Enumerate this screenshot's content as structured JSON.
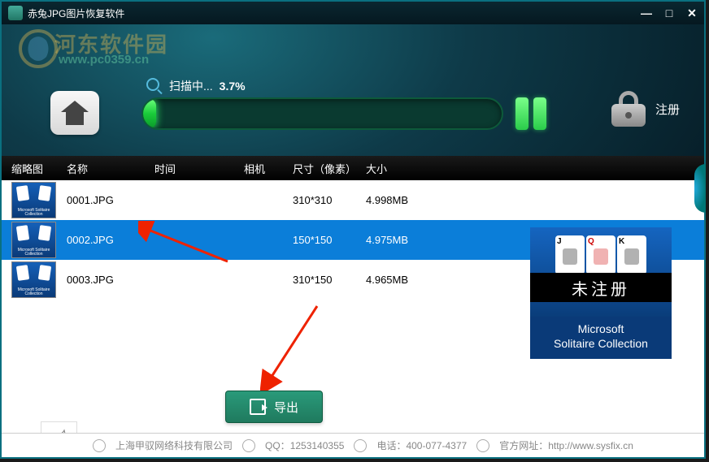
{
  "window": {
    "title": "赤兔JPG图片恢复软件"
  },
  "watermark": {
    "site_name": "河东软件园",
    "url": "www.pc0359.cn"
  },
  "scan": {
    "status_label": "扫描中...",
    "percent": "3.7%",
    "progress_value": 3.7
  },
  "register": {
    "label": "注册"
  },
  "table": {
    "headers": {
      "thumbnail": "缩略图",
      "name": "名称",
      "time": "时间",
      "camera": "相机",
      "dimensions": "尺寸（像素）",
      "size": "大小"
    },
    "rows": [
      {
        "name": "0001.JPG",
        "time": "",
        "camera": "",
        "dimensions": "310*310",
        "size": "4.998MB",
        "thumb_caption": "Microsoft Solitaire Collection",
        "selected": false
      },
      {
        "name": "0002.JPG",
        "time": "",
        "camera": "",
        "dimensions": "150*150",
        "size": "4.975MB",
        "thumb_caption": "Microsoft Solitaire Collection",
        "selected": true
      },
      {
        "name": "0003.JPG",
        "time": "",
        "camera": "",
        "dimensions": "310*150",
        "size": "4.965MB",
        "thumb_caption": "Microsoft Solitaire Collection",
        "selected": false
      }
    ]
  },
  "preview": {
    "unregistered_label": "未注册",
    "caption_line1": "Microsoft",
    "caption_line2": "Solitaire Collection"
  },
  "export": {
    "label": "导出"
  },
  "footer": {
    "company": "上海甲驭网络科技有限公司",
    "qq_label": "QQ：",
    "qq_value": "1253140355",
    "tel_label": "电话：",
    "tel_value": "400-077-4377",
    "site_label": "官方网址：",
    "site_value": "http://www.sysfix.cn"
  },
  "colors": {
    "selection": "#0b7ed9",
    "progress_green": "#2acc4a",
    "header_bg": "#0e3a48",
    "export_btn": "#2a9a7a"
  }
}
